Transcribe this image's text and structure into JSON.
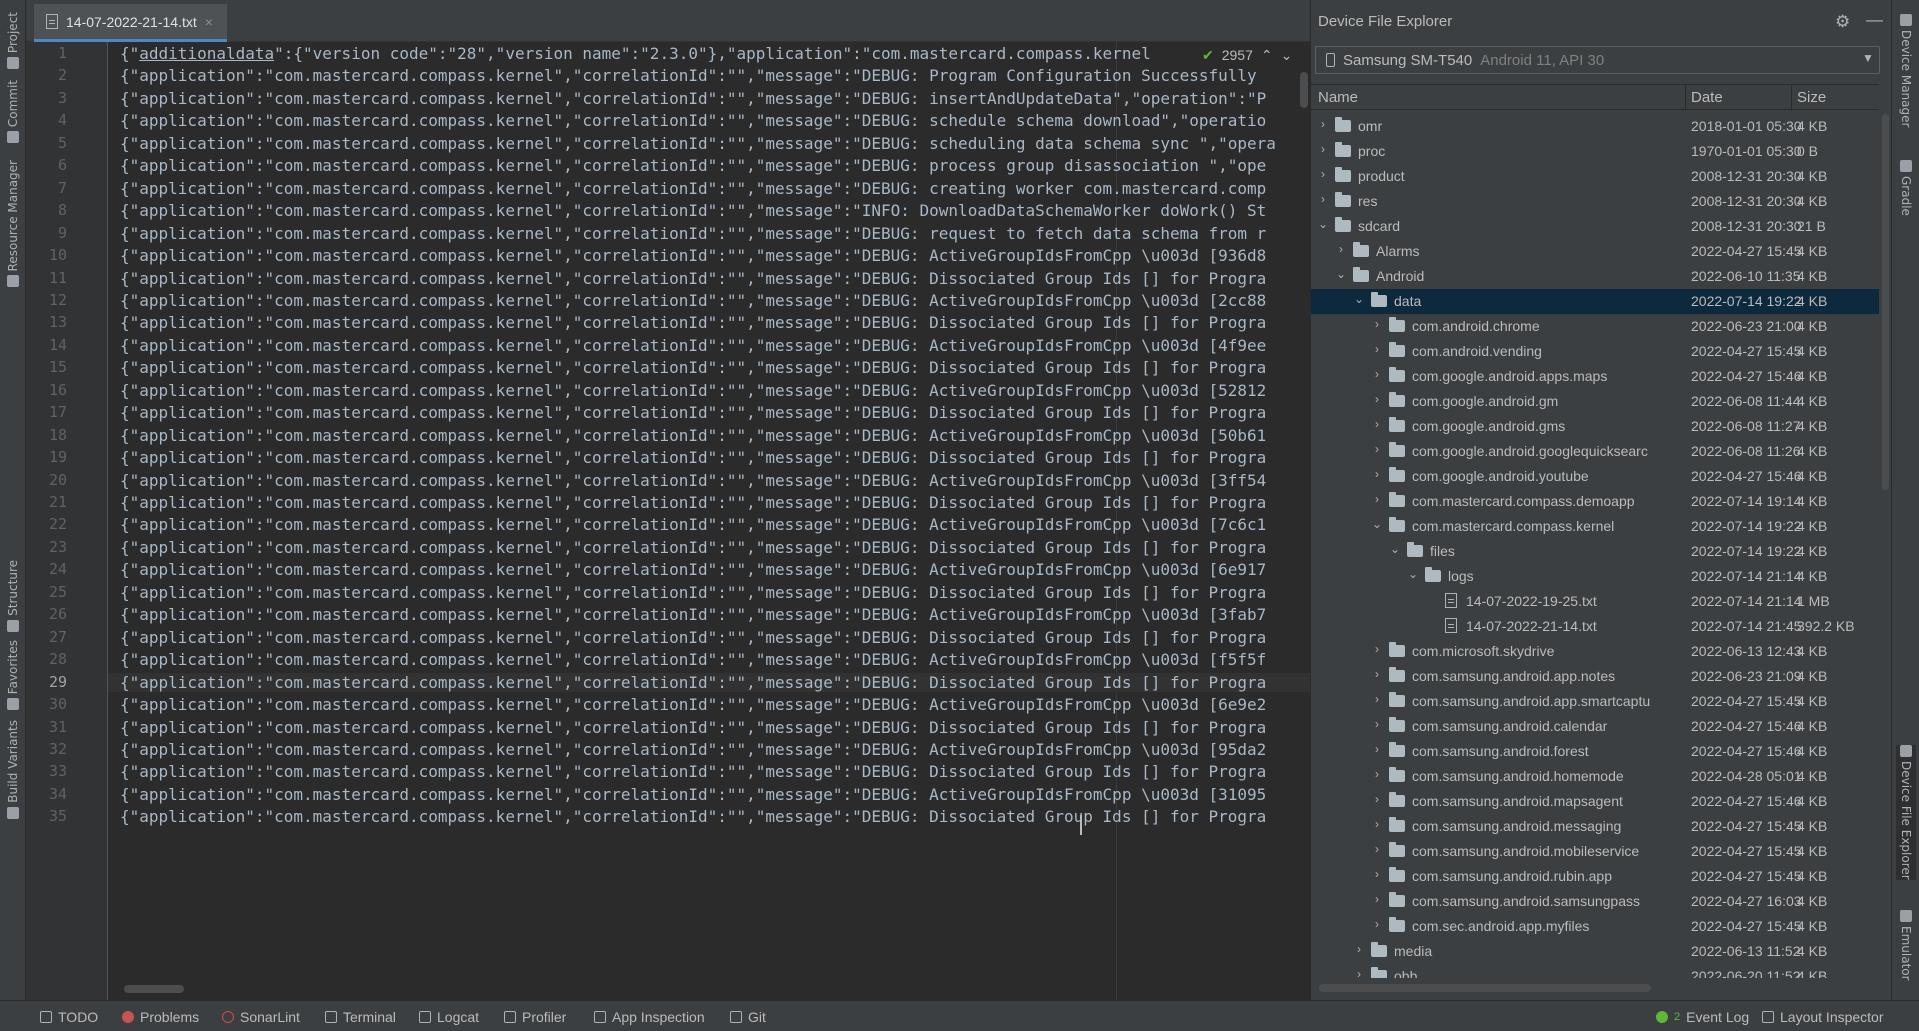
{
  "editor": {
    "tab_title": "14-07-2022-21-14.txt",
    "close_glyph": "×",
    "inspection_count": "2957",
    "current_line": 29,
    "first_line_prefix": "{\"",
    "first_line_underlined": "additionaldata",
    "first_line_suffix": "\":{\"version code\":\"28\",\"version name\":\"2.3.0\"},\"application\":\"com.mastercard.compass.kernel",
    "lines": [
      {
        "n": "1",
        "text": ""
      },
      {
        "n": "2",
        "text": "{\"application\":\"com.mastercard.compass.kernel\",\"correlationId\":\"\",\"message\":\"DEBUG: Program Configuration Successfully"
      },
      {
        "n": "3",
        "text": "{\"application\":\"com.mastercard.compass.kernel\",\"correlationId\":\"\",\"message\":\"DEBUG: insertAndUpdateData\",\"operation\":\"P"
      },
      {
        "n": "4",
        "text": "{\"application\":\"com.mastercard.compass.kernel\",\"correlationId\":\"\",\"message\":\"DEBUG: schedule schema download\",\"operatio"
      },
      {
        "n": "5",
        "text": "{\"application\":\"com.mastercard.compass.kernel\",\"correlationId\":\"\",\"message\":\"DEBUG: scheduling data schema sync \",\"opera"
      },
      {
        "n": "6",
        "text": "{\"application\":\"com.mastercard.compass.kernel\",\"correlationId\":\"\",\"message\":\"DEBUG: process group disassociation \",\"ope"
      },
      {
        "n": "7",
        "text": "{\"application\":\"com.mastercard.compass.kernel\",\"correlationId\":\"\",\"message\":\"DEBUG: creating worker com.mastercard.comp"
      },
      {
        "n": "8",
        "text": "{\"application\":\"com.mastercard.compass.kernel\",\"correlationId\":\"\",\"message\":\"INFO: DownloadDataSchemaWorker doWork() St"
      },
      {
        "n": "9",
        "text": "{\"application\":\"com.mastercard.compass.kernel\",\"correlationId\":\"\",\"message\":\"DEBUG: request to fetch data schema from r"
      },
      {
        "n": "10",
        "text": "{\"application\":\"com.mastercard.compass.kernel\",\"correlationId\":\"\",\"message\":\"DEBUG: ActiveGroupIdsFromCpp \\u003d [936d8"
      },
      {
        "n": "11",
        "text": "{\"application\":\"com.mastercard.compass.kernel\",\"correlationId\":\"\",\"message\":\"DEBUG: Dissociated Group Ids [] for Progra"
      },
      {
        "n": "12",
        "text": "{\"application\":\"com.mastercard.compass.kernel\",\"correlationId\":\"\",\"message\":\"DEBUG: ActiveGroupIdsFromCpp \\u003d [2cc88"
      },
      {
        "n": "13",
        "text": "{\"application\":\"com.mastercard.compass.kernel\",\"correlationId\":\"\",\"message\":\"DEBUG: Dissociated Group Ids [] for Progra"
      },
      {
        "n": "14",
        "text": "{\"application\":\"com.mastercard.compass.kernel\",\"correlationId\":\"\",\"message\":\"DEBUG: ActiveGroupIdsFromCpp \\u003d [4f9ee"
      },
      {
        "n": "15",
        "text": "{\"application\":\"com.mastercard.compass.kernel\",\"correlationId\":\"\",\"message\":\"DEBUG: Dissociated Group Ids [] for Progra"
      },
      {
        "n": "16",
        "text": "{\"application\":\"com.mastercard.compass.kernel\",\"correlationId\":\"\",\"message\":\"DEBUG: ActiveGroupIdsFromCpp \\u003d [52812"
      },
      {
        "n": "17",
        "text": "{\"application\":\"com.mastercard.compass.kernel\",\"correlationId\":\"\",\"message\":\"DEBUG: Dissociated Group Ids [] for Progra"
      },
      {
        "n": "18",
        "text": "{\"application\":\"com.mastercard.compass.kernel\",\"correlationId\":\"\",\"message\":\"DEBUG: ActiveGroupIdsFromCpp \\u003d [50b61"
      },
      {
        "n": "19",
        "text": "{\"application\":\"com.mastercard.compass.kernel\",\"correlationId\":\"\",\"message\":\"DEBUG: Dissociated Group Ids [] for Progra"
      },
      {
        "n": "20",
        "text": "{\"application\":\"com.mastercard.compass.kernel\",\"correlationId\":\"\",\"message\":\"DEBUG: ActiveGroupIdsFromCpp \\u003d [3ff54"
      },
      {
        "n": "21",
        "text": "{\"application\":\"com.mastercard.compass.kernel\",\"correlationId\":\"\",\"message\":\"DEBUG: Dissociated Group Ids [] for Progra"
      },
      {
        "n": "22",
        "text": "{\"application\":\"com.mastercard.compass.kernel\",\"correlationId\":\"\",\"message\":\"DEBUG: ActiveGroupIdsFromCpp \\u003d [7c6c1"
      },
      {
        "n": "23",
        "text": "{\"application\":\"com.mastercard.compass.kernel\",\"correlationId\":\"\",\"message\":\"DEBUG: Dissociated Group Ids [] for Progra"
      },
      {
        "n": "24",
        "text": "{\"application\":\"com.mastercard.compass.kernel\",\"correlationId\":\"\",\"message\":\"DEBUG: ActiveGroupIdsFromCpp \\u003d [6e917"
      },
      {
        "n": "25",
        "text": "{\"application\":\"com.mastercard.compass.kernel\",\"correlationId\":\"\",\"message\":\"DEBUG: Dissociated Group Ids [] for Progra"
      },
      {
        "n": "26",
        "text": "{\"application\":\"com.mastercard.compass.kernel\",\"correlationId\":\"\",\"message\":\"DEBUG: ActiveGroupIdsFromCpp \\u003d [3fab7"
      },
      {
        "n": "27",
        "text": "{\"application\":\"com.mastercard.compass.kernel\",\"correlationId\":\"\",\"message\":\"DEBUG: Dissociated Group Ids [] for Progra"
      },
      {
        "n": "28",
        "text": "{\"application\":\"com.mastercard.compass.kernel\",\"correlationId\":\"\",\"message\":\"DEBUG: ActiveGroupIdsFromCpp \\u003d [f5f5f"
      },
      {
        "n": "29",
        "text": "{\"application\":\"com.mastercard.compass.kernel\",\"correlationId\":\"\",\"message\":\"DEBUG: Dissociated Group Ids [] for Progra"
      },
      {
        "n": "30",
        "text": "{\"application\":\"com.mastercard.compass.kernel\",\"correlationId\":\"\",\"message\":\"DEBUG: ActiveGroupIdsFromCpp \\u003d [6e9e2"
      },
      {
        "n": "31",
        "text": "{\"application\":\"com.mastercard.compass.kernel\",\"correlationId\":\"\",\"message\":\"DEBUG: Dissociated Group Ids [] for Progra"
      },
      {
        "n": "32",
        "text": "{\"application\":\"com.mastercard.compass.kernel\",\"correlationId\":\"\",\"message\":\"DEBUG: ActiveGroupIdsFromCpp \\u003d [95da2"
      },
      {
        "n": "33",
        "text": "{\"application\":\"com.mastercard.compass.kernel\",\"correlationId\":\"\",\"message\":\"DEBUG: Dissociated Group Ids [] for Progra"
      },
      {
        "n": "34",
        "text": "{\"application\":\"com.mastercard.compass.kernel\",\"correlationId\":\"\",\"message\":\"DEBUG: ActiveGroupIdsFromCpp \\u003d [31095"
      },
      {
        "n": "35",
        "text": "{\"application\":\"com.mastercard.compass.kernel\",\"correlationId\":\"\",\"message\":\"DEBUG: Dissociated Group Ids [] for Progra"
      }
    ]
  },
  "left_strip": {
    "tabs": [
      "Project",
      "Commit",
      "Resource Manager",
      "Structure",
      "Favorites",
      "Build Variants"
    ]
  },
  "right_strip": {
    "tabs": [
      "Device Manager",
      "Gradle",
      "Device File Explorer",
      "Emulator"
    ]
  },
  "explorer": {
    "title": "Device File Explorer",
    "device_name": "Samsung SM-T540",
    "device_detail": "Android 11, API 30",
    "columns": {
      "name": "Name",
      "date": "Date",
      "size": "Size"
    },
    "rows": [
      {
        "name": "omr",
        "date": "2018-01-01 05:30",
        "size": "4 KB",
        "depth": 0,
        "type": "folder",
        "state": "collapsed"
      },
      {
        "name": "proc",
        "date": "1970-01-01 05:30",
        "size": "0 B",
        "depth": 0,
        "type": "folder",
        "state": "collapsed"
      },
      {
        "name": "product",
        "date": "2008-12-31 20:30",
        "size": "4 KB",
        "depth": 0,
        "type": "folder",
        "state": "collapsed"
      },
      {
        "name": "res",
        "date": "2008-12-31 20:30",
        "size": "4 KB",
        "depth": 0,
        "type": "folder",
        "state": "collapsed"
      },
      {
        "name": "sdcard",
        "date": "2008-12-31 20:30",
        "size": "21 B",
        "depth": 0,
        "type": "folder",
        "state": "expanded"
      },
      {
        "name": "Alarms",
        "date": "2022-04-27 15:45",
        "size": "4 KB",
        "depth": 1,
        "type": "folder",
        "state": "collapsed"
      },
      {
        "name": "Android",
        "date": "2022-06-10 11:35",
        "size": "4 KB",
        "depth": 1,
        "type": "folder",
        "state": "expanded"
      },
      {
        "name": "data",
        "date": "2022-07-14 19:22",
        "size": "4 KB",
        "depth": 2,
        "type": "folder",
        "state": "expanded",
        "selected": true
      },
      {
        "name": "com.android.chrome",
        "date": "2022-06-23 21:00",
        "size": "4 KB",
        "depth": 3,
        "type": "folder",
        "state": "collapsed"
      },
      {
        "name": "com.android.vending",
        "date": "2022-04-27 15:45",
        "size": "4 KB",
        "depth": 3,
        "type": "folder",
        "state": "collapsed"
      },
      {
        "name": "com.google.android.apps.maps",
        "date": "2022-04-27 15:46",
        "size": "4 KB",
        "depth": 3,
        "type": "folder",
        "state": "collapsed"
      },
      {
        "name": "com.google.android.gm",
        "date": "2022-06-08 11:44",
        "size": "4 KB",
        "depth": 3,
        "type": "folder",
        "state": "collapsed"
      },
      {
        "name": "com.google.android.gms",
        "date": "2022-06-08 11:27",
        "size": "4 KB",
        "depth": 3,
        "type": "folder",
        "state": "collapsed"
      },
      {
        "name": "com.google.android.googlequicksearc",
        "date": "2022-06-08 11:26",
        "size": "4 KB",
        "depth": 3,
        "type": "folder",
        "state": "collapsed"
      },
      {
        "name": "com.google.android.youtube",
        "date": "2022-04-27 15:46",
        "size": "4 KB",
        "depth": 3,
        "type": "folder",
        "state": "collapsed"
      },
      {
        "name": "com.mastercard.compass.demoapp",
        "date": "2022-07-14 19:14",
        "size": "4 KB",
        "depth": 3,
        "type": "folder",
        "state": "collapsed"
      },
      {
        "name": "com.mastercard.compass.kernel",
        "date": "2022-07-14 19:22",
        "size": "4 KB",
        "depth": 3,
        "type": "folder",
        "state": "expanded"
      },
      {
        "name": "files",
        "date": "2022-07-14 19:22",
        "size": "4 KB",
        "depth": 4,
        "type": "folder",
        "state": "expanded"
      },
      {
        "name": "logs",
        "date": "2022-07-14 21:14",
        "size": "4 KB",
        "depth": 5,
        "type": "folder",
        "state": "expanded"
      },
      {
        "name": "14-07-2022-19-25.txt",
        "date": "2022-07-14 21:14",
        "size": "1 MB",
        "depth": 6,
        "type": "file",
        "state": "none"
      },
      {
        "name": "14-07-2022-21-14.txt",
        "date": "2022-07-14 21:45",
        "size": "392.2 KB",
        "depth": 6,
        "type": "file",
        "state": "none"
      },
      {
        "name": "com.microsoft.skydrive",
        "date": "2022-06-13 12:43",
        "size": "4 KB",
        "depth": 3,
        "type": "folder",
        "state": "collapsed"
      },
      {
        "name": "com.samsung.android.app.notes",
        "date": "2022-06-23 21:09",
        "size": "4 KB",
        "depth": 3,
        "type": "folder",
        "state": "collapsed"
      },
      {
        "name": "com.samsung.android.app.smartcaptu",
        "date": "2022-04-27 15:45",
        "size": "4 KB",
        "depth": 3,
        "type": "folder",
        "state": "collapsed"
      },
      {
        "name": "com.samsung.android.calendar",
        "date": "2022-04-27 15:46",
        "size": "4 KB",
        "depth": 3,
        "type": "folder",
        "state": "collapsed"
      },
      {
        "name": "com.samsung.android.forest",
        "date": "2022-04-27 15:46",
        "size": "4 KB",
        "depth": 3,
        "type": "folder",
        "state": "collapsed"
      },
      {
        "name": "com.samsung.android.homemode",
        "date": "2022-04-28 05:01",
        "size": "4 KB",
        "depth": 3,
        "type": "folder",
        "state": "collapsed"
      },
      {
        "name": "com.samsung.android.mapsagent",
        "date": "2022-04-27 15:46",
        "size": "4 KB",
        "depth": 3,
        "type": "folder",
        "state": "collapsed"
      },
      {
        "name": "com.samsung.android.messaging",
        "date": "2022-04-27 15:45",
        "size": "4 KB",
        "depth": 3,
        "type": "folder",
        "state": "collapsed"
      },
      {
        "name": "com.samsung.android.mobileservice",
        "date": "2022-04-27 15:45",
        "size": "4 KB",
        "depth": 3,
        "type": "folder",
        "state": "collapsed"
      },
      {
        "name": "com.samsung.android.rubin.app",
        "date": "2022-04-27 15:45",
        "size": "4 KB",
        "depth": 3,
        "type": "folder",
        "state": "collapsed"
      },
      {
        "name": "com.samsung.android.samsungpass",
        "date": "2022-04-27 16:03",
        "size": "4 KB",
        "depth": 3,
        "type": "folder",
        "state": "collapsed"
      },
      {
        "name": "com.sec.android.app.myfiles",
        "date": "2022-04-27 15:45",
        "size": "4 KB",
        "depth": 3,
        "type": "folder",
        "state": "collapsed"
      },
      {
        "name": "media",
        "date": "2022-06-13 11:52",
        "size": "4 KB",
        "depth": 2,
        "type": "folder",
        "state": "collapsed"
      },
      {
        "name": "obb",
        "date": "2022-06-20 11:52",
        "size": "4 KB",
        "depth": 2,
        "type": "folder",
        "state": "collapsed"
      }
    ]
  },
  "status_bar": {
    "items": [
      "TODO",
      "Problems",
      "SonarLint",
      "Terminal",
      "Logcat",
      "Profiler",
      "App Inspection",
      "Git"
    ],
    "right_items": [
      "Event Log",
      "Layout Inspector"
    ],
    "event_log_count": "2"
  }
}
